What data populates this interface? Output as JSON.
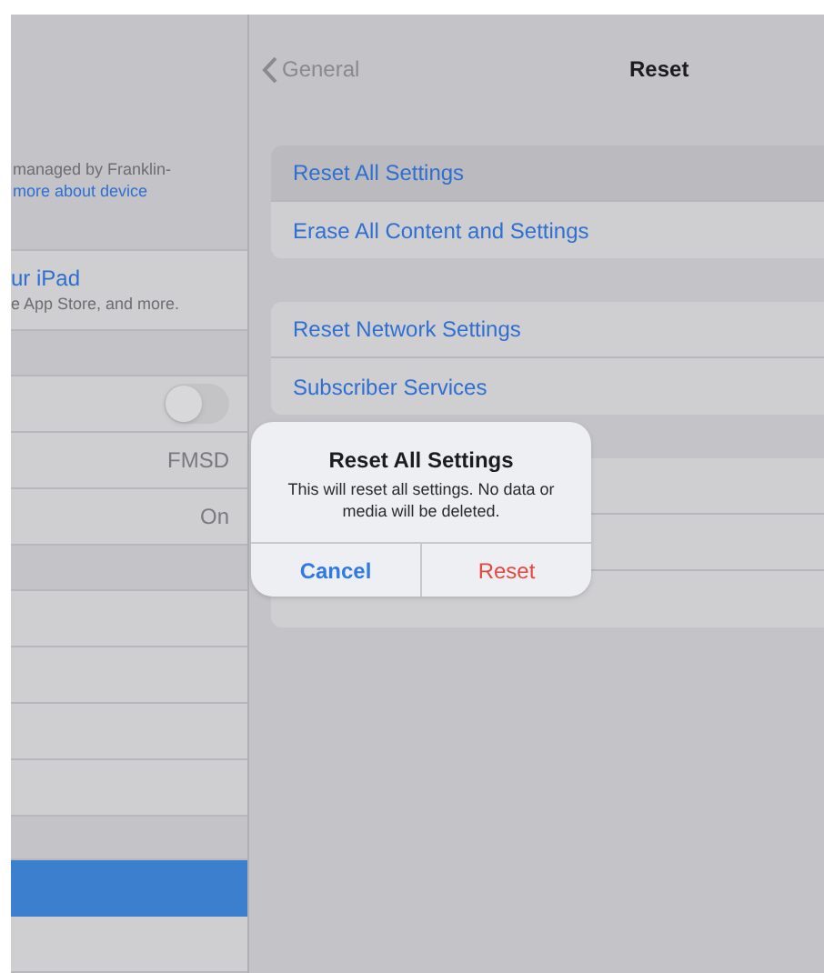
{
  "sidebar": {
    "header_text": "managed by Franklin-",
    "header_link": "more about device",
    "account": {
      "title": "ur iPad",
      "subtitle": "e App Store, and more."
    },
    "groups": [
      {
        "rows": [
          {
            "kind": "toggle",
            "on": false,
            "selected": false
          },
          {
            "kind": "value",
            "value": "FMSD",
            "selected": false
          },
          {
            "kind": "value",
            "value": "On",
            "selected": false
          }
        ]
      },
      {
        "rows": [
          {
            "kind": "plain",
            "selected": false
          },
          {
            "kind": "plain",
            "selected": false
          },
          {
            "kind": "plain",
            "selected": false
          },
          {
            "kind": "plain",
            "selected": false
          }
        ]
      },
      {
        "rows": [
          {
            "kind": "plain",
            "selected": true
          },
          {
            "kind": "plain",
            "selected": false
          }
        ]
      }
    ]
  },
  "nav": {
    "back": "General",
    "title": "Reset"
  },
  "groups": [
    {
      "rows": [
        {
          "label": "Reset All Settings",
          "highlighted": true
        },
        {
          "label": "Erase All Content and Settings",
          "highlighted": false
        }
      ]
    },
    {
      "rows": [
        {
          "label": "Reset Network Settings",
          "highlighted": false
        },
        {
          "label": "Subscriber Services",
          "highlighted": false
        }
      ]
    },
    {
      "rows": [
        {
          "highlighted": false
        },
        {
          "highlighted": false
        },
        {
          "highlighted": false
        }
      ]
    }
  ],
  "alert": {
    "title": "Reset All Settings",
    "message": "This will reset all settings. No data or media will be deleted.",
    "buttons": [
      {
        "label": "Cancel",
        "kind": "cancel"
      },
      {
        "label": "Reset",
        "kind": "destructive"
      }
    ]
  }
}
